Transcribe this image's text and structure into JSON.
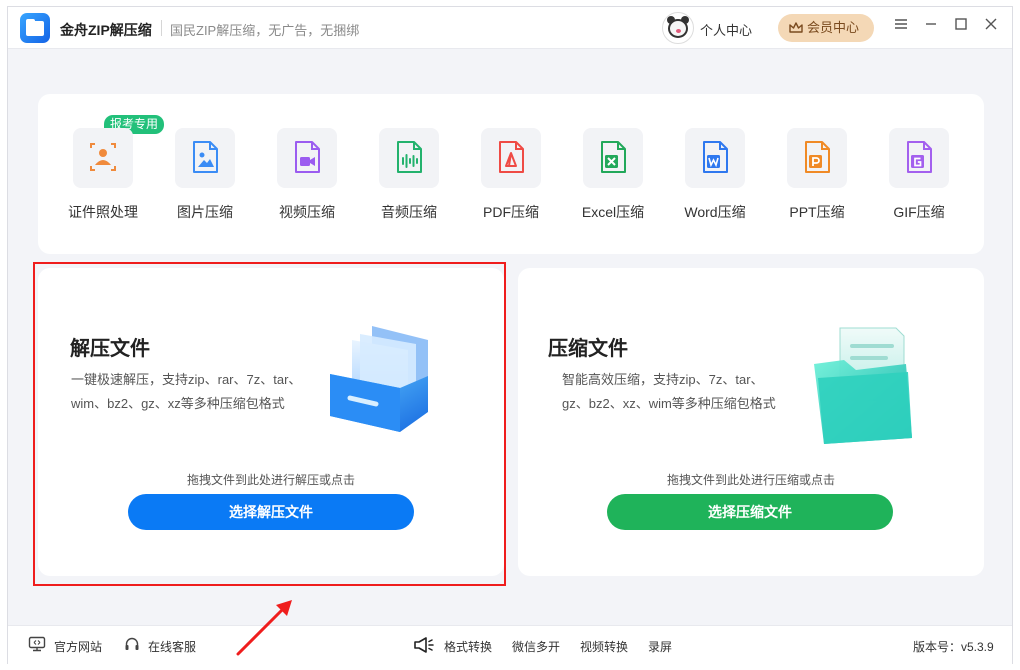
{
  "titlebar": {
    "app_name": "金舟ZIP解压缩",
    "slogan": "国民ZIP解压缩，无广告，无捆绑",
    "personal_center": "个人中心",
    "vip_center": "会员中心",
    "menu_icon": "hamburger-icon",
    "minimize_icon": "minimize-icon",
    "maximize_icon": "maximize-icon",
    "close_icon": "close-icon"
  },
  "tools": {
    "exam_tag": "报考专用",
    "items": [
      {
        "label": "证件照处理",
        "icon": "id-photo-icon",
        "color": "#f08a3c"
      },
      {
        "label": "图片压缩",
        "icon": "image-icon",
        "color": "#3b8cf5"
      },
      {
        "label": "视频压缩",
        "icon": "video-icon",
        "color": "#9b5cf0"
      },
      {
        "label": "音频压缩",
        "icon": "audio-icon",
        "color": "#23b26d"
      },
      {
        "label": "PDF压缩",
        "icon": "pdf-icon",
        "color": "#ef4b45"
      },
      {
        "label": "Excel压缩",
        "icon": "excel-icon",
        "color": "#22a85a"
      },
      {
        "label": "Word压缩",
        "icon": "word-icon",
        "color": "#2f78ef"
      },
      {
        "label": "PPT压缩",
        "icon": "ppt-icon",
        "color": "#f08a26"
      },
      {
        "label": "GIF压缩",
        "icon": "gif-icon",
        "color": "#a360ee"
      }
    ]
  },
  "extract": {
    "title": "解压文件",
    "desc": "一键极速解压，支持zip、rar、7z、tar、wim、bz2、gz、xz等多种压缩包格式",
    "hint": "拖拽文件到此处进行解压或点击",
    "button": "选择解压文件",
    "button_color": "#0a7af5"
  },
  "compress": {
    "title": "压缩文件",
    "desc": "智能高效压缩，支持zip、7z、tar、gz、bz2、xz、wim等多种压缩包格式",
    "hint": "拖拽文件到此处进行压缩或点击",
    "button": "选择压缩文件",
    "button_color": "#1fb35a"
  },
  "footer": {
    "website": "官方网站",
    "service": "在线客服",
    "format_convert": "格式转换",
    "wechat_multi": "微信多开",
    "video_convert": "视频转换",
    "record": "录屏",
    "version": "版本号：v5.3.9"
  },
  "colors": {
    "highlight_box": "#ef1d1d",
    "background": "#f3f4f8"
  }
}
